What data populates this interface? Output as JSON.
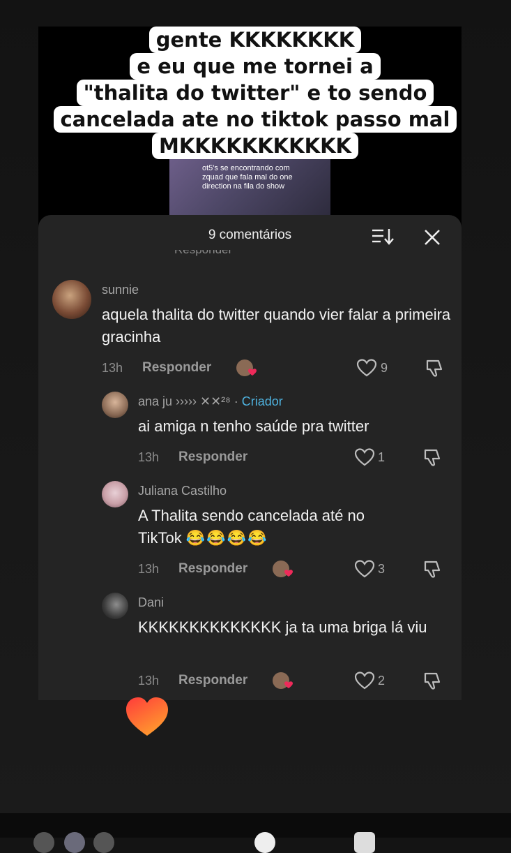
{
  "story": {
    "caption_lines": [
      "gente KKKKKKKK",
      "e eu que me tornei a",
      "\"thalita do twitter\" e to sendo",
      "cancelada ate no tiktok passo mal",
      "MKKKKKKKKKKK"
    ],
    "video_text": "ot5's se encontrando com zquad que fala mal do one direction na fila do show"
  },
  "comments_panel": {
    "title": "9 comentários",
    "cut_off_reply_label": "Responder",
    "comments": [
      {
        "username": "sunnie",
        "text": "aquela thalita do twitter quando vier falar a primeira gracinha",
        "time": "13h",
        "reply_label": "Responder",
        "likes": "9",
        "creator_liked": true,
        "avatar_color": "#7a4b35"
      },
      {
        "username": "ana ju ›››››",
        "username_suffix": " ✕✕²⁸ · ",
        "creator_label": "Criador",
        "text": "ai amiga n tenho saúde pra twitter",
        "time": "13h",
        "reply_label": "Responder",
        "likes": "1",
        "creator_liked": false,
        "avatar_color": "#8a6a55"
      },
      {
        "username": "Juliana Castilho",
        "text_line1": "A Thalita sendo cancelada até no",
        "text_line2": "TikTok",
        "emojis": [
          "😂",
          "😂",
          "😂",
          "😂"
        ],
        "time": "13h",
        "reply_label": "Responder",
        "likes": "3",
        "creator_liked": true,
        "avatar_color": "#c9a0a8"
      },
      {
        "username": "Dani",
        "text": "KKKKKKKKKKKKKK ja ta uma briga lá viu",
        "time": "13h",
        "reply_label": "Responder",
        "likes": "2",
        "creator_liked": true,
        "avatar_color": "#3a3a3a"
      }
    ]
  },
  "icons": {
    "sort": "sort-icon",
    "close": "close-icon",
    "like": "heart-outline-icon",
    "dislike": "thumbs-down-icon",
    "creator_like": "creator-liked-icon",
    "sticker": "heart-sticker-icon"
  },
  "colors": {
    "panel_bg": "#242424",
    "creator_blue": "#4fb3e0",
    "creator_heart": "#ee2a5a",
    "sticker_gradient_start": "#ff3b3b",
    "sticker_gradient_end": "#ff9a2e"
  }
}
